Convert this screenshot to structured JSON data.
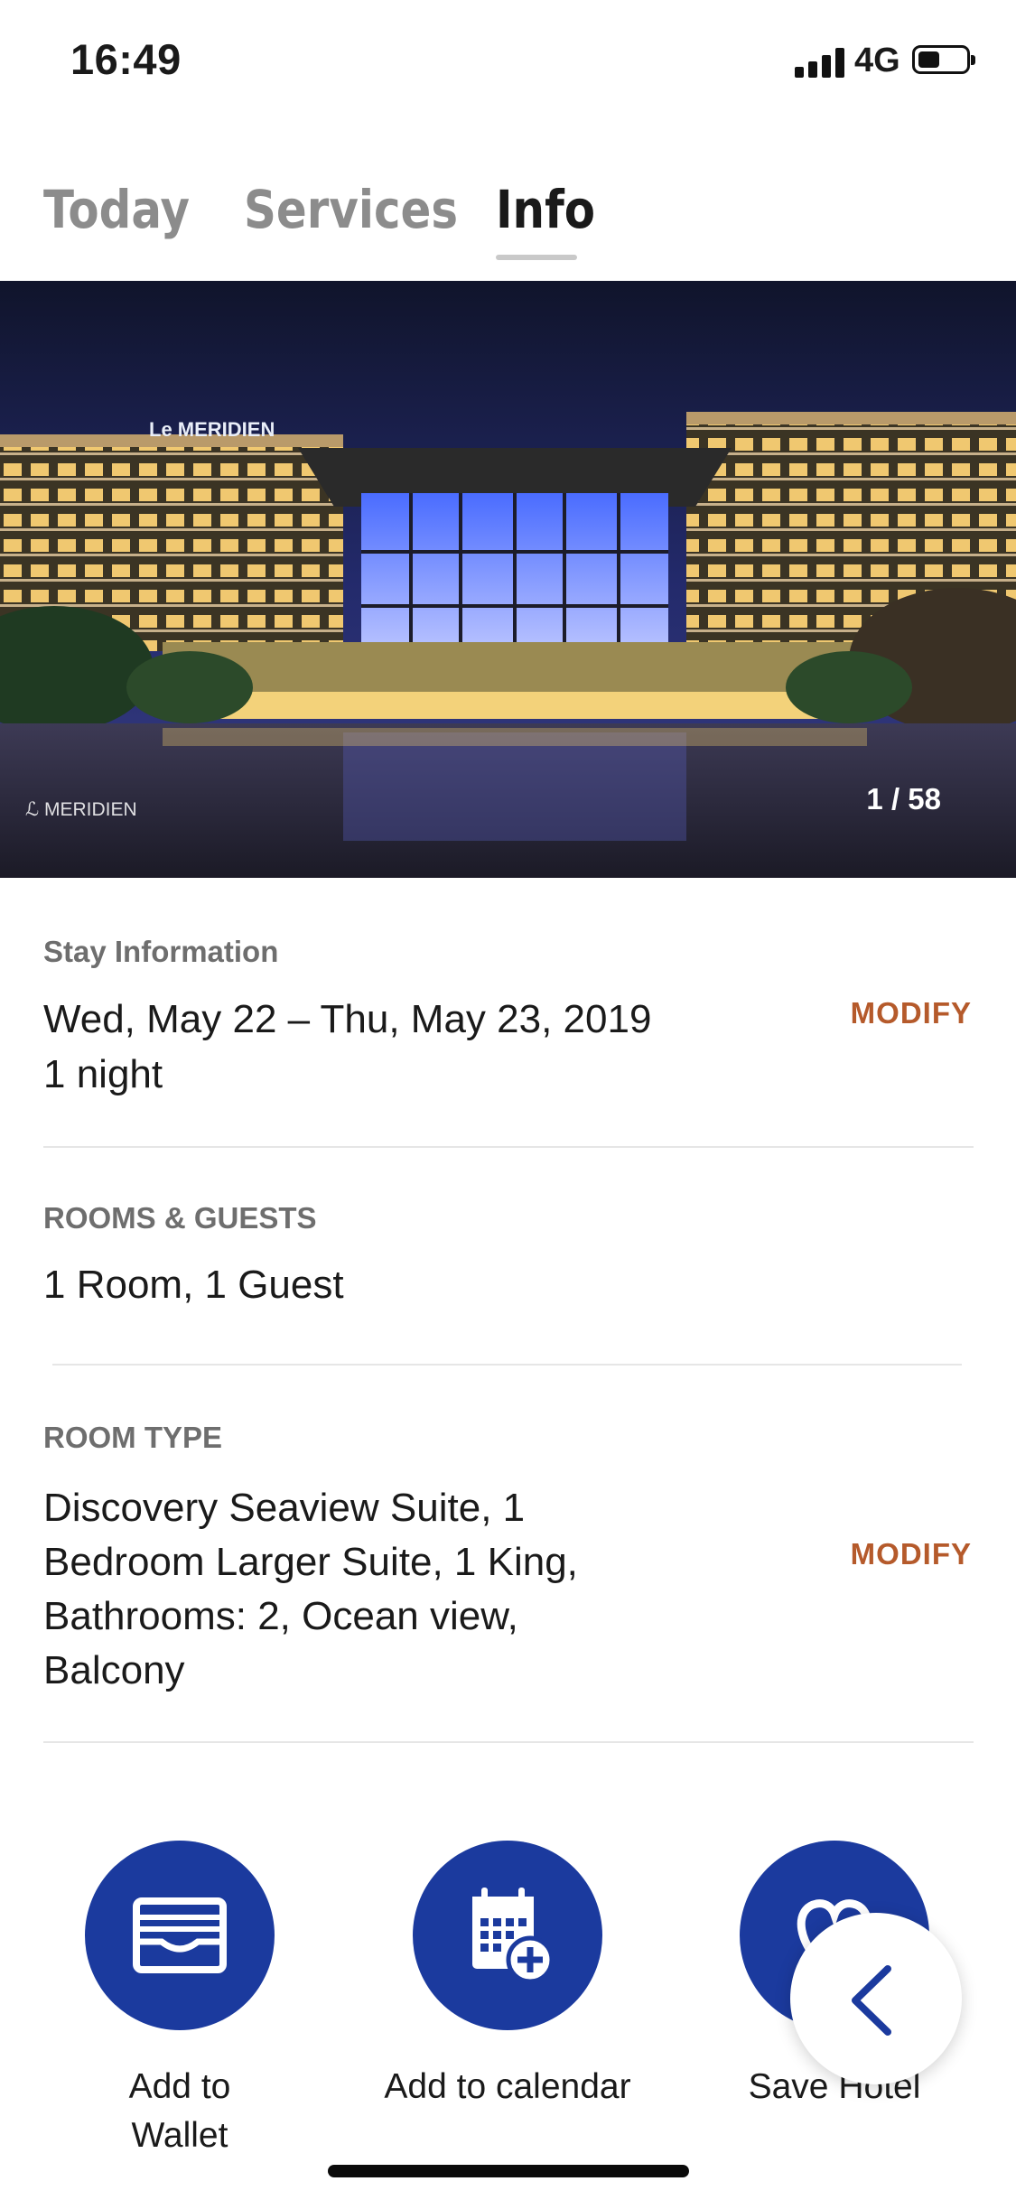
{
  "status_bar": {
    "time": "16:49",
    "network": "4G",
    "battery_level": 0.45
  },
  "tabs": [
    {
      "label": "Today",
      "active": false
    },
    {
      "label": "Services",
      "active": false
    },
    {
      "label": "Info",
      "active": true
    }
  ],
  "hero": {
    "brand_sign": "Le MERIDIEN",
    "brand_watermark": "MERIDIEN",
    "photo_counter": "1 / 58"
  },
  "stay": {
    "label": "Stay Information",
    "dates": "Wed, May 22 – Thu, May 23, 2019",
    "nights": "1 night",
    "modify_label": "MODIFY"
  },
  "rooms_guests": {
    "label": "ROOMS & GUESTS",
    "value": "1 Room, 1 Guest"
  },
  "room_type": {
    "label": "ROOM TYPE",
    "lines": [
      "Discovery Seaview Suite, 1",
      "Bedroom Larger Suite, 1 King,",
      "Bathrooms: 2, Ocean view,",
      "Balcony"
    ],
    "modify_label": "MODIFY"
  },
  "actions": [
    {
      "icon": "wallet-icon",
      "label_line1": "Add to",
      "label_line2": "Wallet"
    },
    {
      "icon": "calendar-add-icon",
      "label_line1": "Add to calendar",
      "label_line2": ""
    },
    {
      "icon": "heart-icon",
      "label_line1": "Save Hotel",
      "label_line2": ""
    }
  ],
  "colors": {
    "accent": "#1b3a9e",
    "modify": "#b55a2b",
    "tab_inactive": "#8c8c8c"
  }
}
